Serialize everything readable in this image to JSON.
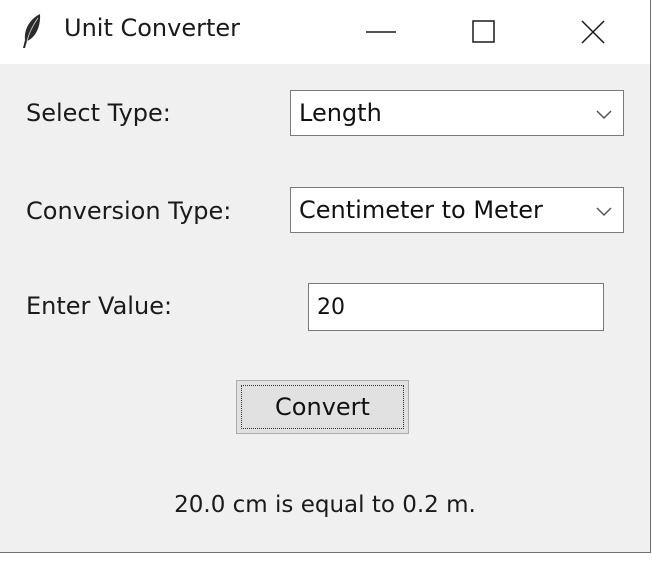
{
  "window": {
    "title": "Unit Converter",
    "app_icon": "feather-icon",
    "controls": [
      "minimize-icon",
      "maximize-icon",
      "close-icon"
    ]
  },
  "form": {
    "select_type_label": "Select Type:",
    "select_type_value": "Length",
    "conversion_type_label": "Conversion Type:",
    "conversion_type_value": "Centimeter to Meter",
    "enter_value_label": "Enter Value:",
    "enter_value_value": "20",
    "convert_label": "Convert"
  },
  "result": {
    "text": "20.0 cm is equal to 0.2 m."
  }
}
